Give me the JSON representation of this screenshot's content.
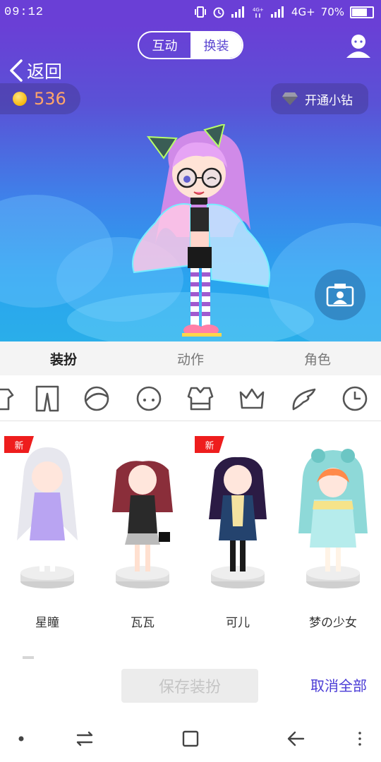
{
  "status_bar": {
    "time": "09:12",
    "network_label": "4G+",
    "battery": "70%",
    "battery_level": 0.7,
    "icons": [
      "vibrate-icon",
      "alarm-icon",
      "signal-icon",
      "signal-4g-icon",
      "signal-icon",
      "battery-icon"
    ]
  },
  "header": {
    "back_label": "返回",
    "segment_tabs": [
      {
        "label": "互动",
        "active": false
      },
      {
        "label": "换装",
        "active": true
      }
    ],
    "profile_icon": "profile-icon"
  },
  "wallet": {
    "coins": "536",
    "coin_icon": "coin-icon",
    "vip_label": "开通小钻",
    "vip_icon": "diamond-icon"
  },
  "camera_icon": "camera-icon",
  "main_tabs": [
    {
      "label": "装扮",
      "active": true
    },
    {
      "label": "动作",
      "active": false
    },
    {
      "label": "角色",
      "active": false
    }
  ],
  "categories": [
    "top-icon",
    "pants-icon",
    "face-icon",
    "head-icon",
    "outfit-set-icon",
    "crown-icon",
    "wing-icon",
    "clock-icon"
  ],
  "outfits": [
    {
      "name": "星瞳",
      "is_new": true,
      "badge": "新"
    },
    {
      "name": "瓦瓦",
      "is_new": false,
      "badge": ""
    },
    {
      "name": "可儿",
      "is_new": true,
      "badge": "新"
    },
    {
      "name": "梦の少女",
      "is_new": false,
      "badge": ""
    }
  ],
  "actions": {
    "save_label": "保存装扮",
    "save_enabled": false,
    "cancel_label": "取消全部"
  },
  "system_nav": [
    "dot-icon",
    "switch-icon",
    "home-square-icon",
    "back-arrow-icon",
    "menu-dots-icon"
  ],
  "colors": {
    "accent": "#4a3bd6",
    "coin_text": "#ffa56a",
    "new_badge": "#ee1d1d",
    "hero_top": "#6a3fd6",
    "hero_bottom": "#2aaee9"
  }
}
